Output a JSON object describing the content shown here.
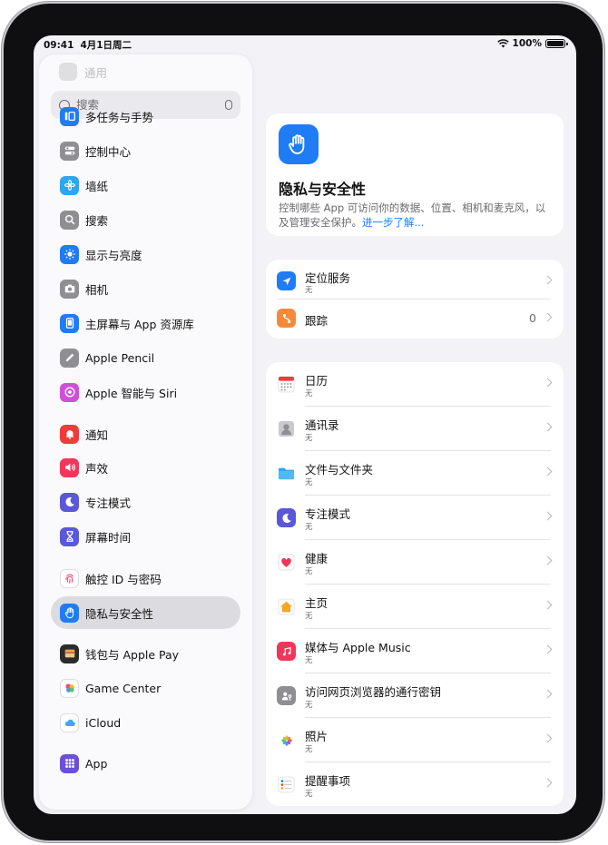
{
  "status": {
    "time": "09:41",
    "date": "4月1日周二",
    "battery": "100%"
  },
  "sidebar": {
    "title": "通用",
    "search_placeholder": "搜索",
    "items": [
      {
        "label": "多任务与手势",
        "icon": "multitask-icon",
        "color": "#1f7cf5"
      },
      {
        "label": "控制中心",
        "icon": "control-center-icon",
        "color": "#8e8e93"
      },
      {
        "label": "墙纸",
        "icon": "wallpaper-icon",
        "color": "#2aa7f0"
      },
      {
        "label": "搜索",
        "icon": "search-icon",
        "color": "#8e8e93"
      },
      {
        "label": "显示与亮度",
        "icon": "brightness-icon",
        "color": "#1f7cf5"
      },
      {
        "label": "相机",
        "icon": "camera-icon",
        "color": "#8e8e93"
      },
      {
        "label": "主屏幕与 App 资源库",
        "icon": "home-screen-icon",
        "color": "#1f7cf5"
      },
      {
        "label": "Apple Pencil",
        "icon": "pencil-icon",
        "color": "#8e8e93"
      },
      {
        "label": "Apple 智能与 Siri",
        "icon": "siri-icon",
        "color": "#d04fd8"
      },
      {
        "label": "通知",
        "icon": "bell-icon",
        "color": "#f23a3a"
      },
      {
        "label": "声效",
        "icon": "speaker-icon",
        "color": "#f2365b"
      },
      {
        "label": "专注模式",
        "icon": "moon-icon",
        "color": "#5b57d9"
      },
      {
        "label": "屏幕时间",
        "icon": "hourglass-icon",
        "color": "#5b57d9"
      },
      {
        "label": "触控 ID 与密码",
        "icon": "fingerprint-icon",
        "color": "#ffffff"
      },
      {
        "label": "隐私与安全性",
        "icon": "hand-icon",
        "color": "#1f7cf5"
      },
      {
        "label": "钱包与 Apple Pay",
        "icon": "wallet-icon",
        "color": "#2b2b2b"
      },
      {
        "label": "Game Center",
        "icon": "game-center-icon",
        "color": "#ffffff"
      },
      {
        "label": "iCloud",
        "icon": "icloud-icon",
        "color": "#ffffff"
      },
      {
        "label": "App",
        "icon": "apps-grid-icon",
        "color": "#6b4fd8"
      }
    ]
  },
  "hero": {
    "title": "隐私与安全性",
    "description": "控制哪些 App 可访问你的数据、位置、相机和麦克风，以及管理安全保护。",
    "link": "进一步了解..."
  },
  "group1": [
    {
      "title": "定位服务",
      "subtitle": "无",
      "icon": "location-icon",
      "color": "#1f7cf5"
    },
    {
      "title": "跟踪",
      "subtitle": "",
      "value": "0",
      "icon": "tracking-icon",
      "color": "#f5893a"
    }
  ],
  "group2": [
    {
      "title": "日历",
      "subtitle": "无",
      "icon": "calendar-icon"
    },
    {
      "title": "通讯录",
      "subtitle": "无",
      "icon": "contacts-icon"
    },
    {
      "title": "文件与文件夹",
      "subtitle": "无",
      "icon": "folder-icon"
    },
    {
      "title": "专注模式",
      "subtitle": "无",
      "icon": "moon-icon"
    },
    {
      "title": "健康",
      "subtitle": "无",
      "icon": "heart-icon"
    },
    {
      "title": "主页",
      "subtitle": "无",
      "icon": "home-icon"
    },
    {
      "title": "媒体与 Apple Music",
      "subtitle": "无",
      "icon": "music-icon"
    },
    {
      "title": "访问网页浏览器的通行密钥",
      "subtitle": "无",
      "icon": "passkey-icon"
    },
    {
      "title": "照片",
      "subtitle": "无",
      "icon": "photos-icon"
    },
    {
      "title": "提醒事项",
      "subtitle": "无",
      "icon": "reminders-icon"
    }
  ]
}
